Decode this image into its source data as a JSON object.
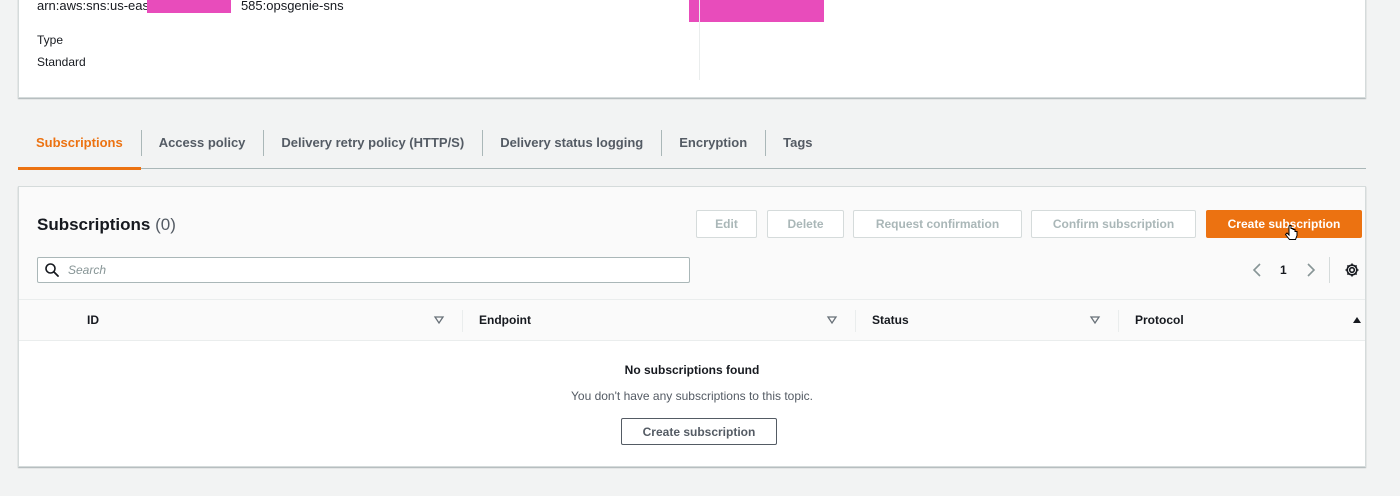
{
  "topic": {
    "arn_prefix": "arn:aws:sns:us-east-",
    "arn_suffix": "585:opsgenie-sns",
    "type_label": "Type",
    "type_value": "Standard"
  },
  "tabs": [
    {
      "label": "Subscriptions",
      "active": true
    },
    {
      "label": "Access policy",
      "active": false
    },
    {
      "label": "Delivery retry policy (HTTP/S)",
      "active": false
    },
    {
      "label": "Delivery status logging",
      "active": false
    },
    {
      "label": "Encryption",
      "active": false
    },
    {
      "label": "Tags",
      "active": false
    }
  ],
  "subscriptions": {
    "title": "Subscriptions",
    "count": "(0)",
    "buttons": {
      "edit": "Edit",
      "delete": "Delete",
      "request_confirmation": "Request confirmation",
      "confirm_subscription": "Confirm subscription",
      "create_subscription": "Create subscription"
    },
    "search_placeholder": "Search",
    "search_value": "",
    "page": "1",
    "columns": [
      "ID",
      "Endpoint",
      "Status",
      "Protocol"
    ],
    "empty": {
      "title": "No subscriptions found",
      "description": "You don't have any subscriptions to this topic.",
      "button": "Create subscription"
    }
  },
  "colors": {
    "accent": "#ec7211",
    "redaction": "#e84cbb"
  },
  "icons": [
    "search-icon",
    "chevron-left-icon",
    "chevron-right-icon",
    "settings-gear-icon",
    "sort-caret-down-icon",
    "sort-caret-up-icon",
    "pointer-cursor-icon"
  ]
}
